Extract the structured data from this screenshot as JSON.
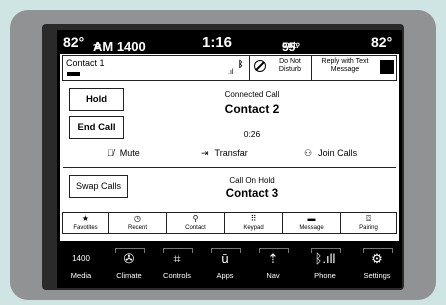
{
  "status_bar": {
    "temp_left": "82°",
    "radio_icon": "radio-signal-icon",
    "radio_station": "AM 1400",
    "time": "1:16",
    "outside_temp": "55°",
    "outside_suffix": "out.",
    "temp_right": "82°"
  },
  "contact_bar": {
    "name": "Contact 1",
    "dnd_label": "Do Not Disturb",
    "reply_label": "Reply with Text Message"
  },
  "call": {
    "hold_label": "Hold",
    "end_label": "End Call",
    "connected_label": "Connected Call",
    "connected_name": "Contact 2",
    "timer": "0:26",
    "mute_label": "Mute",
    "transfer_label": "Transfar",
    "join_label": "Join Calls",
    "swap_label": "Swap Calls",
    "hold_status_label": "Call On Hold",
    "hold_name": "Contact 3"
  },
  "phone_tabs": [
    {
      "label": "Favotites",
      "icon": "star-icon"
    },
    {
      "label": "Recent",
      "icon": "clock-icon"
    },
    {
      "label": "Contact",
      "icon": "person-icon"
    },
    {
      "label": "Keypad",
      "icon": "keypad-icon"
    },
    {
      "label": "Message",
      "icon": "message-icon"
    },
    {
      "label": "Pairing",
      "icon": "pairing-icon"
    }
  ],
  "bottom_nav": [
    {
      "label": "Media",
      "icon_text": "1400"
    },
    {
      "label": "Climate",
      "icon": "climate-icon"
    },
    {
      "label": "Controls",
      "icon": "controls-icon"
    },
    {
      "label": "Apps",
      "icon": "apps-icon"
    },
    {
      "label": "Nav",
      "icon": "nav-icon"
    },
    {
      "label": "Phone",
      "icon": "phone-signal-icon"
    },
    {
      "label": "Settings",
      "icon": "gear-icon"
    }
  ]
}
